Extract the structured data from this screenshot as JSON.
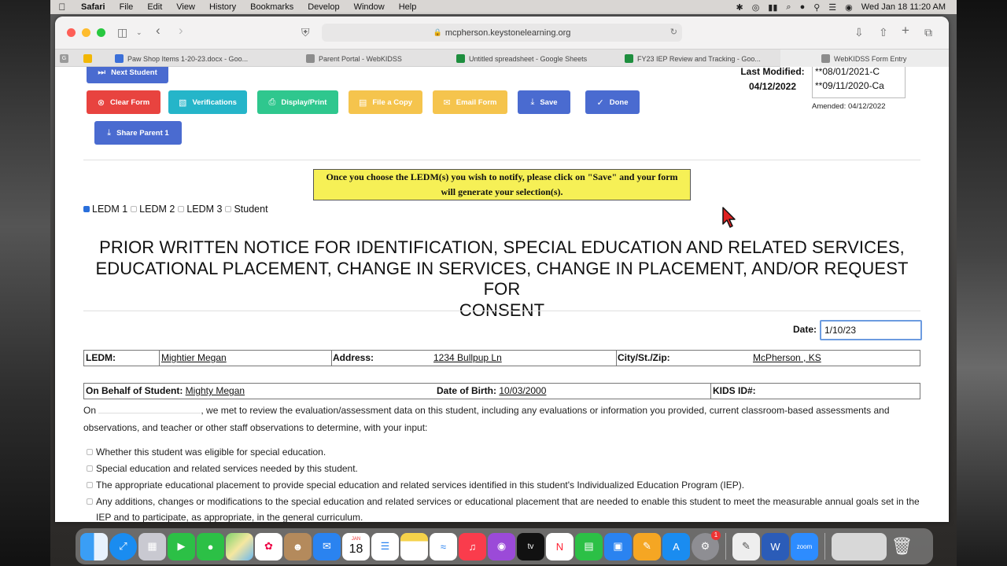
{
  "menubar": {
    "app": "Safari",
    "items": [
      "File",
      "Edit",
      "View",
      "History",
      "Bookmarks",
      "Develop",
      "Window",
      "Help"
    ],
    "datetime": "Wed Jan 18  11:20 AM"
  },
  "browser": {
    "url": "mcpherson.keystonelearning.org",
    "tabs": [
      {
        "label": "Paw Shop Items 1-20-23.docx - Goo...",
        "color": "#3b6fd8"
      },
      {
        "label": "Parent Portal - WebKIDSS",
        "color": "#8c8c8c"
      },
      {
        "label": "Untitled spreadsheet - Google Sheets",
        "color": "#1e8e3e"
      },
      {
        "label": "FY23 IEP Review and Tracking - Goo...",
        "color": "#1e8e3e"
      },
      {
        "label": "WebKIDSS Form Entry",
        "color": "#8c8c8c"
      }
    ]
  },
  "form": {
    "buttons": {
      "next_student": "Next Student",
      "clear_form": "Clear Form",
      "verifications": "Verifications",
      "display_print": "Display/Print",
      "file_copy": "File a Copy",
      "email_form": "Email Form",
      "save": "Save",
      "done": "Done",
      "share_parent": "Share Parent 1"
    },
    "last_modified_label": "Last Modified:",
    "last_modified_date": "04/12/2022",
    "history_entries": [
      "**08/01/2021-C",
      "**09/11/2020-Ca"
    ],
    "amended": "Amended: 04/12/2022",
    "notice_line1": "Once you choose the LEDM(s) you wish to notify, please click on \"Save\" and your form",
    "notice_line2": "will generate your selection(s).",
    "recipients": [
      {
        "label": "LEDM 1",
        "checked": true
      },
      {
        "label": "LEDM 2",
        "checked": false
      },
      {
        "label": "LEDM 3",
        "checked": false
      },
      {
        "label": "Student",
        "checked": false
      }
    ],
    "title_line1": "PRIOR WRITTEN NOTICE FOR IDENTIFICATION, SPECIAL EDUCATION AND RELATED SERVICES,",
    "title_line2": "EDUCATIONAL PLACEMENT, CHANGE IN SERVICES, CHANGE IN PLACEMENT, AND/OR REQUEST FOR",
    "title_line3": "CONSENT",
    "date_label": "Date:",
    "date_value": "1/10/23",
    "ledm_label": "LEDM:",
    "ledm_value": "Mightier Megan",
    "address_label": "Address:",
    "address_value": "1234 Bullpup Ln",
    "city_label": "City/St./Zip:",
    "city_value": "McPherson , KS",
    "behalf_label": "On Behalf of Student:",
    "behalf_value": "Mighty Megan",
    "dob_label": "Date of Birth:",
    "dob_value": "10/03/2000",
    "kids_label": "KIDS ID#:",
    "para_on": "On",
    "para_rest": ", we met to review the evaluation/assessment data on this student, including any evaluations or information you provided, current classroom-based assessments and observations, and teacher or other staff observations to determine, with your input:",
    "options": [
      "Whether this student was eligible for special education.",
      "Special education and related services needed by this student.",
      "The appropriate educational placement to provide special education and related services identified in this student's Individualized Education Program (IEP).",
      "Any additions, changes or modifications to the special education and related services or educational placement that are needed to enable this student to meet the measurable annual goals set in the IEP and to participate, as appropriate, in the general curriculum."
    ]
  },
  "dock": {
    "calendar_month": "JAN",
    "calendar_day": "18",
    "settings_badge": "1",
    "apps": [
      "finder-icon",
      "safari-icon",
      "launchpad-icon",
      "facetime-icon",
      "messages-icon",
      "maps-icon",
      "photos-icon",
      "contacts-icon",
      "mail-icon",
      "calendar-icon",
      "reminders-icon",
      "notes-icon",
      "freeform-icon",
      "music-icon",
      "podcasts-icon",
      "appletv-icon",
      "news-icon",
      "numbers-icon",
      "keynote-icon",
      "pages-icon",
      "appstore-icon",
      "settings-icon"
    ]
  }
}
